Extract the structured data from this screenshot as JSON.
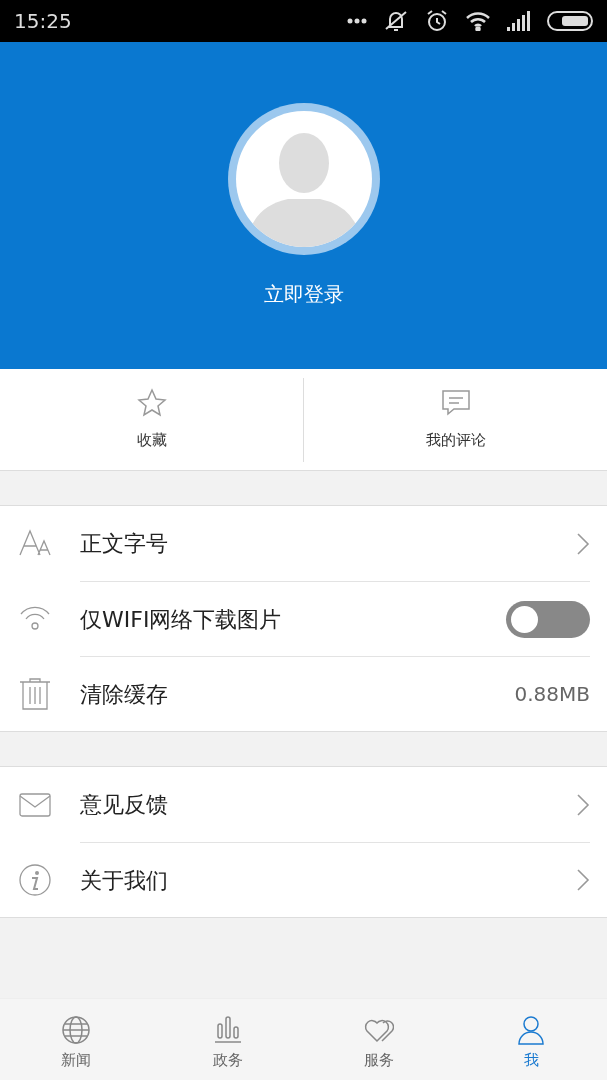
{
  "status_bar": {
    "time": "15:25"
  },
  "profile": {
    "login_label": "立即登录"
  },
  "quick_actions": [
    {
      "label": "收藏"
    },
    {
      "label": "我的评论"
    }
  ],
  "settings_groups": [
    [
      {
        "kind": "link",
        "label": "正文字号"
      },
      {
        "kind": "toggle",
        "label": "仅WIFI网络下载图片",
        "on": false
      },
      {
        "kind": "value",
        "label": "清除缓存",
        "value": "0.88MB"
      }
    ],
    [
      {
        "kind": "link",
        "label": "意见反馈"
      },
      {
        "kind": "link",
        "label": "关于我们"
      }
    ]
  ],
  "tabs": [
    {
      "label": "新闻",
      "selected": false
    },
    {
      "label": "政务",
      "selected": false
    },
    {
      "label": "服务",
      "selected": false
    },
    {
      "label": "我",
      "selected": true
    }
  ]
}
